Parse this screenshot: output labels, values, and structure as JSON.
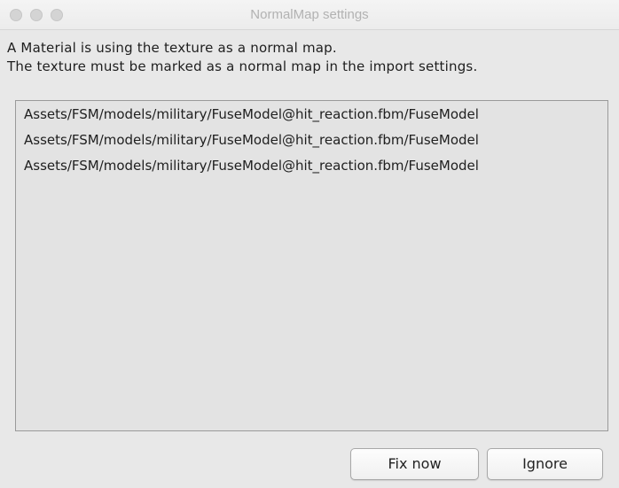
{
  "window": {
    "title": "NormalMap settings"
  },
  "message": {
    "line1": "A Material is using the texture as a normal map.",
    "line2": "The texture must be marked as a normal map in the import settings."
  },
  "list": {
    "items": [
      "Assets/FSM/models/military/FuseModel@hit_reaction.fbm/FuseModel",
      "Assets/FSM/models/military/FuseModel@hit_reaction.fbm/FuseModel",
      "Assets/FSM/models/military/FuseModel@hit_reaction.fbm/FuseModel"
    ]
  },
  "buttons": {
    "fix_now": "Fix now",
    "ignore": "Ignore"
  }
}
